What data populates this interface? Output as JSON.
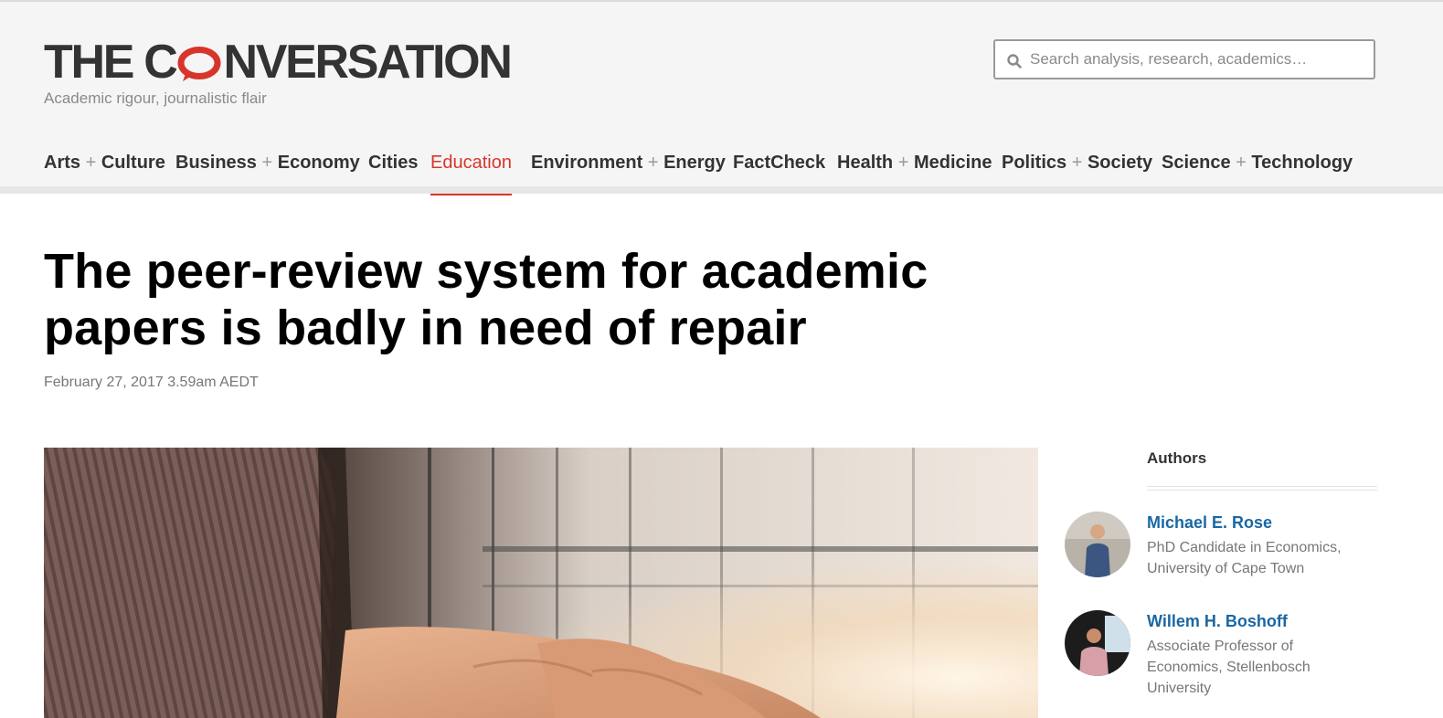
{
  "site": {
    "logo_text_left": "THE C",
    "logo_text_right": "NVERSATION",
    "tagline": "Academic rigour, journalistic flair",
    "brand_color": "#d8352a"
  },
  "search": {
    "placeholder": "Search analysis, research, academics…",
    "value": ""
  },
  "nav": {
    "items": [
      {
        "a": "Arts",
        "b": "Culture"
      },
      {
        "a": "Business",
        "b": "Economy"
      },
      {
        "a": "Cities"
      },
      {
        "a": "Education",
        "active": true
      },
      {
        "a": "Environment",
        "b": "Energy"
      },
      {
        "a": "FactCheck"
      },
      {
        "a": "Health",
        "b": "Medicine"
      },
      {
        "a": "Politics",
        "b": "Society"
      },
      {
        "a": "Science",
        "b": "Technology"
      }
    ],
    "plus": "+"
  },
  "article": {
    "headline": "The peer-review system for academic papers is badly in need of repair",
    "dateline": "February 27, 2017 3.59am AEDT"
  },
  "authors": {
    "heading": "Authors",
    "list": [
      {
        "name": "Michael E. Rose",
        "role": "PhD Candidate in Economics, University of Cape Town"
      },
      {
        "name": "Willem H. Boshoff",
        "role": "Associate Professor of Economics, Stellenbosch University"
      }
    ]
  }
}
